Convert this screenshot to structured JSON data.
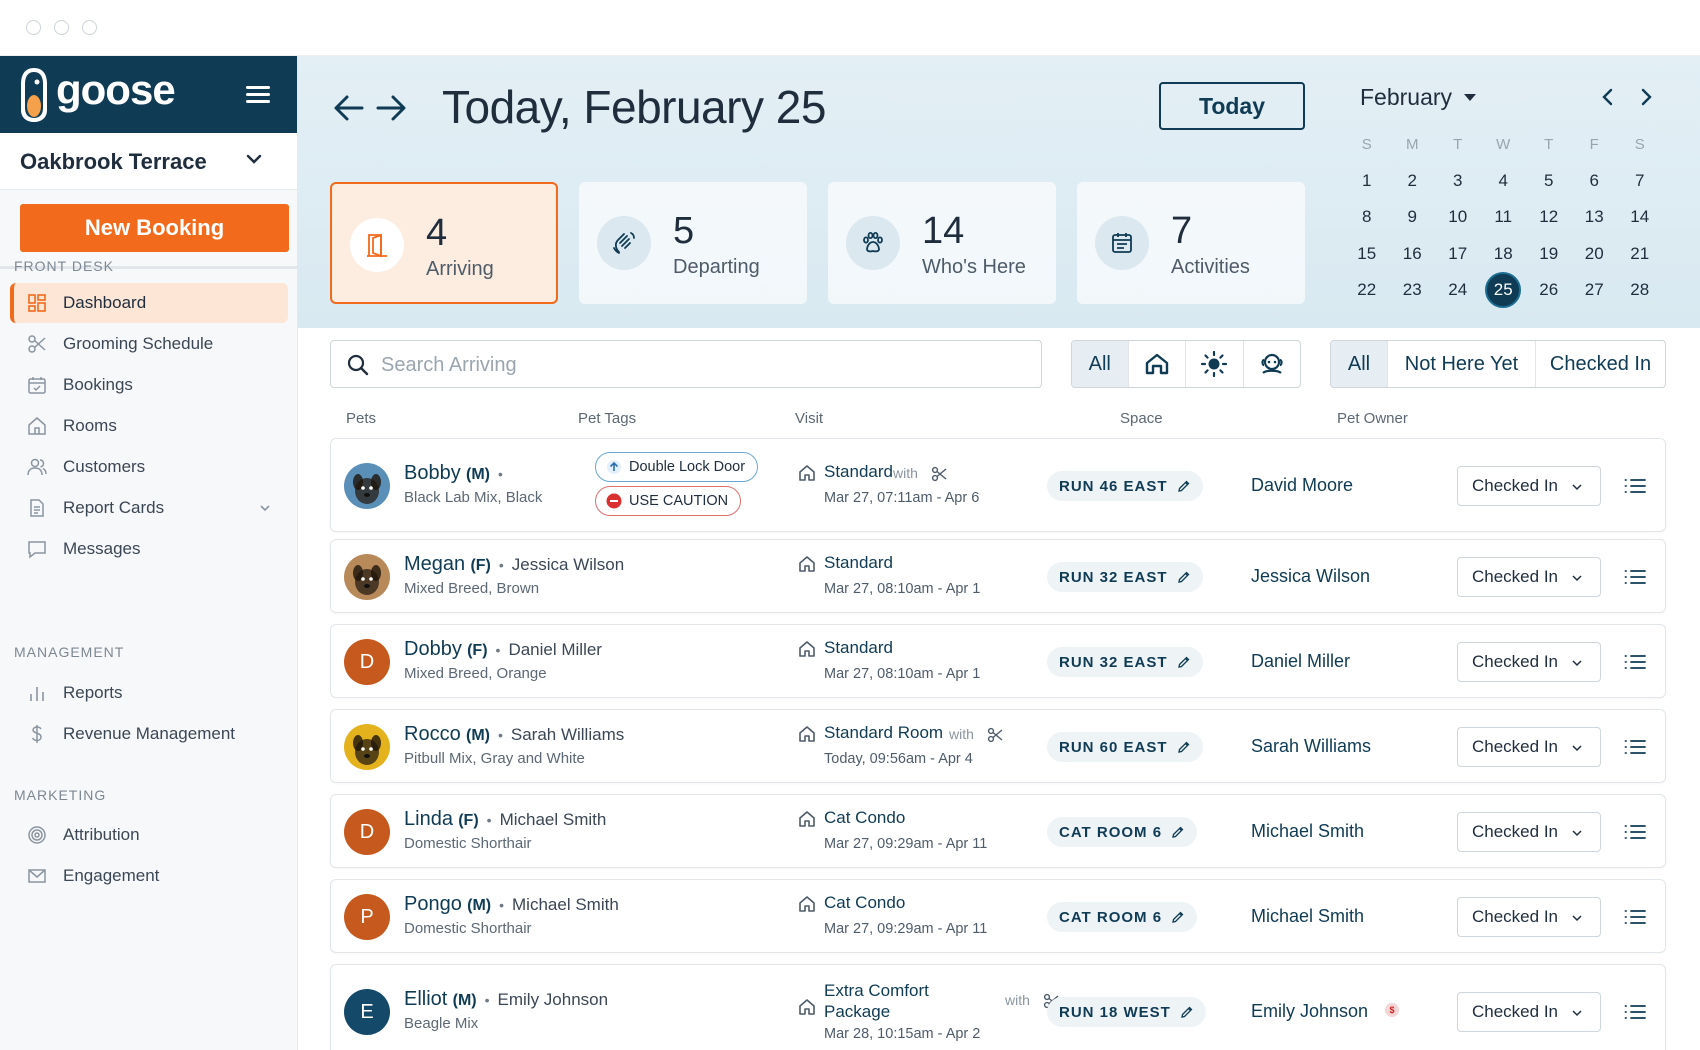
{
  "app": {
    "brand": "goose",
    "location": "Oakbrook Terrace",
    "new_booking": "New Booking"
  },
  "colors": {
    "brand_navy": "#0f3b54",
    "accent_orange": "#f26a1b",
    "active_bg": "#fde6d6"
  },
  "sidebar": {
    "sections": [
      {
        "label": "FRONT DESK",
        "items": [
          {
            "label": "Dashboard",
            "icon": "dashboard-icon",
            "active": true
          },
          {
            "label": "Grooming Schedule",
            "icon": "scissors-icon"
          },
          {
            "label": "Bookings",
            "icon": "calendar-check-icon"
          },
          {
            "label": "Rooms",
            "icon": "home-icon"
          },
          {
            "label": "Customers",
            "icon": "users-icon"
          },
          {
            "label": "Report Cards",
            "icon": "document-icon",
            "expandable": true
          },
          {
            "label": "Messages",
            "icon": "message-icon"
          }
        ]
      },
      {
        "label": "MANAGEMENT",
        "items": [
          {
            "label": "Reports",
            "icon": "bar-chart-icon"
          },
          {
            "label": "Revenue Management",
            "icon": "dollar-icon"
          }
        ]
      },
      {
        "label": "MARKETING",
        "items": [
          {
            "label": "Attribution",
            "icon": "target-icon"
          },
          {
            "label": "Engagement",
            "icon": "mail-icon"
          }
        ]
      }
    ]
  },
  "header": {
    "title": "Today, February 25",
    "today_button": "Today",
    "stats": [
      {
        "value": "4",
        "label": "Arriving",
        "icon": "door-icon",
        "active": true
      },
      {
        "value": "5",
        "label": "Departing",
        "icon": "wave-hand-icon"
      },
      {
        "value": "14",
        "label": "Who's Here",
        "icon": "paw-icon"
      },
      {
        "value": "7",
        "label": "Activities",
        "icon": "calendar-icon"
      }
    ]
  },
  "calendar": {
    "month": "February",
    "weekdays": [
      "S",
      "M",
      "T",
      "W",
      "T",
      "F",
      "S"
    ],
    "weeks": [
      [
        "1",
        "2",
        "3",
        "4",
        "5",
        "6",
        "7"
      ],
      [
        "8",
        "9",
        "10",
        "11",
        "12",
        "13",
        "14"
      ],
      [
        "15",
        "16",
        "17",
        "18",
        "19",
        "20",
        "21"
      ],
      [
        "22",
        "23",
        "24",
        "25",
        "26",
        "27",
        "28"
      ]
    ],
    "selected": "25"
  },
  "filters": {
    "search_placeholder": "Search Arriving",
    "type_filter": {
      "all_label": "All",
      "icons": [
        "house-icon",
        "sun-icon",
        "groomer-icon"
      ]
    },
    "status_filter": [
      "All",
      "Not Here Yet",
      "Checked In"
    ]
  },
  "table": {
    "columns": [
      "Pets",
      "Pet Tags",
      "Visit",
      "Space",
      "Pet Owner"
    ],
    "with_label": "with",
    "rows": [
      {
        "name": "Bobby",
        "sex": "(M)",
        "owner_inline": "",
        "breed": "Black Lab Mix, Black",
        "avatar": "photo",
        "avatar_color": "#5a8fb8",
        "tags": [
          {
            "label": "Double Lock Door",
            "kind": "blue"
          },
          {
            "label": "USE CAUTION",
            "kind": "red"
          }
        ],
        "visit": "Standard",
        "with_grooming": true,
        "dates": "Mar 27, 07:11am - Apr 6",
        "space": "RUN 46 EAST",
        "owner": "David Moore",
        "status": "Checked In"
      },
      {
        "name": "Megan",
        "sex": "(F)",
        "owner_inline": "Jessica Wilson",
        "breed": "Mixed Breed, Brown",
        "avatar": "photo",
        "avatar_color": "#b88a5a",
        "tags": [],
        "visit": "Standard",
        "with_grooming": false,
        "dates": "Mar 27, 08:10am - Apr 1",
        "space": "RUN 32 EAST",
        "owner": "Jessica Wilson",
        "status": "Checked In"
      },
      {
        "name": "Dobby",
        "sex": "(F)",
        "owner_inline": "Daniel Miller",
        "breed": "Mixed Breed, Orange",
        "avatar": "D",
        "avatar_color": "#c65a1e",
        "tags": [],
        "visit": "Standard",
        "with_grooming": false,
        "dates": "Mar 27, 08:10am - Apr 1",
        "space": "RUN 32 EAST",
        "owner": "Daniel Miller",
        "status": "Checked In"
      },
      {
        "name": "Rocco",
        "sex": "(M)",
        "owner_inline": "Sarah Williams",
        "breed": "Pitbull Mix, Gray and White",
        "avatar": "photo",
        "avatar_color": "#e3b21c",
        "tags": [],
        "visit": "Standard Room",
        "with_grooming": true,
        "dates": "Today, 09:56am - Apr 4",
        "space": "RUN 60 EAST",
        "owner": "Sarah Williams",
        "status": "Checked In"
      },
      {
        "name": "Linda",
        "sex": "(F)",
        "owner_inline": "Michael Smith",
        "breed": "Domestic Shorthair",
        "avatar": "D",
        "avatar_color": "#c65a1e",
        "tags": [],
        "visit": "Cat Condo",
        "with_grooming": false,
        "dates": "Mar 27, 09:29am - Apr 11",
        "space": "CAT ROOM 6",
        "owner": "Michael Smith",
        "status": "Checked In"
      },
      {
        "name": "Pongo",
        "sex": "(M)",
        "owner_inline": "Michael Smith",
        "breed": "Domestic Shorthair",
        "avatar": "P",
        "avatar_color": "#c65a1e",
        "tags": [],
        "visit": "Cat Condo",
        "with_grooming": false,
        "dates": "Mar 27, 09:29am - Apr 11",
        "space": "CAT ROOM 6",
        "owner": "Michael Smith",
        "status": "Checked In"
      },
      {
        "name": "Elliot",
        "sex": "(M)",
        "owner_inline": "Emily Johnson",
        "breed": "Beagle Mix",
        "avatar": "E",
        "avatar_color": "#14496a",
        "tags": [],
        "visit": "Extra Comfort Package",
        "with_grooming": true,
        "dates": "Mar 28, 10:15am - Apr 2",
        "space": "RUN 18 WEST",
        "owner": "Emily Johnson",
        "owner_badge": "$",
        "status": "Checked In"
      }
    ]
  }
}
